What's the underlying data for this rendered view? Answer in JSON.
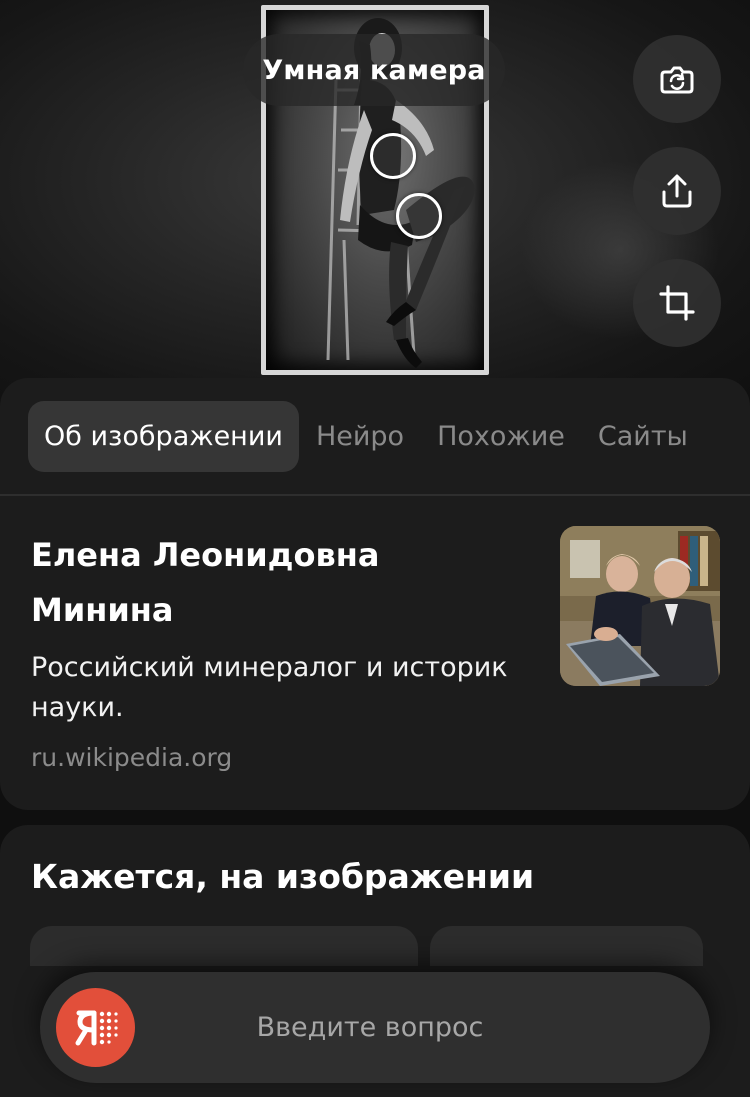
{
  "viewer": {
    "smart_camera_label": "Умная камера",
    "buttons": [
      {
        "icon": "camera-rotate-icon"
      },
      {
        "icon": "share-upload-icon"
      },
      {
        "icon": "crop-icon"
      }
    ]
  },
  "tabs": [
    {
      "label": "Об изображении",
      "active": true
    },
    {
      "label": "Нейро",
      "active": false
    },
    {
      "label": "Похожие",
      "active": false
    },
    {
      "label": "Сайты",
      "active": false
    }
  ],
  "entity": {
    "title_line1": "Елена Леонидовна",
    "title_line2": "Минина",
    "description": "Российский минералог и историк науки.",
    "source": "ru.wikipedia.org"
  },
  "section": {
    "title": "Кажется, на изображении"
  },
  "ask_bar": {
    "placeholder": "Введите вопрос",
    "logo_icon": "alice-logo-icon"
  },
  "colors": {
    "accent": "#e24f3a",
    "sheet": "#1c1c1c",
    "active_tab": "#363636",
    "muted_text": "#8a8a8a"
  }
}
